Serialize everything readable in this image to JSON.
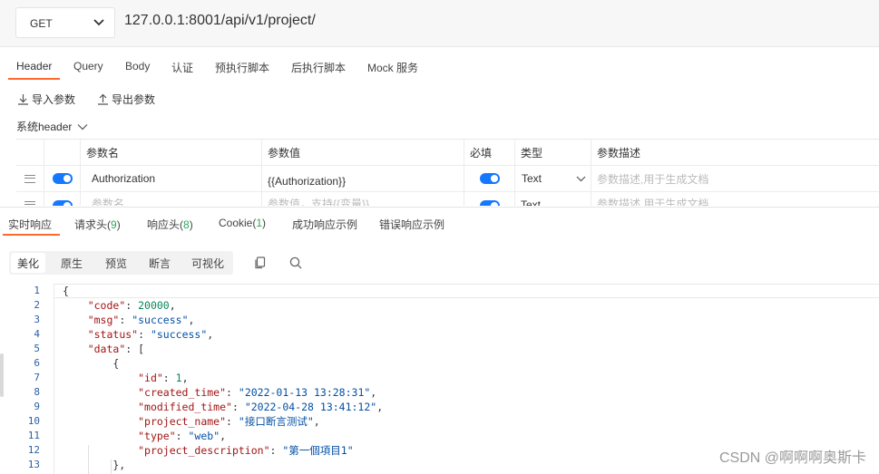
{
  "request": {
    "method": "GET",
    "url": "127.0.0.1:8001/api/v1/project/"
  },
  "req_tabs": [
    "Header",
    "Query",
    "Body",
    "认证",
    "预执行脚本",
    "后执行脚本",
    "Mock 服务"
  ],
  "actions": {
    "import": "导入参数",
    "export": "导出参数"
  },
  "sys_header": "系统header",
  "table": {
    "headers": [
      "参数名",
      "参数值",
      "必填",
      "类型",
      "参数描述"
    ],
    "rows": [
      {
        "name": "Authorization",
        "value": "{{Authorization}}",
        "type": "Text",
        "desc_placeholder": "参数描述,用于生成文档"
      },
      {
        "name_placeholder": "参数名",
        "value_placeholder": "参数值，支持{{变量}}",
        "type": "Text",
        "desc_placeholder": "参数描述,用于生成文档"
      }
    ]
  },
  "resp_tabs": {
    "realtime": "实时响应",
    "req_headers": "请求头",
    "req_headers_count": "9",
    "resp_headers": "响应头",
    "resp_headers_count": "8",
    "cookie": "Cookie",
    "cookie_count": "1",
    "success_example": "成功响应示例",
    "error_example": "错误响应示例"
  },
  "view_modes": [
    "美化",
    "原生",
    "预览",
    "断言",
    "可视化"
  ],
  "icons": [
    "copy-icon",
    "search-icon",
    "upload-icon",
    "download-icon",
    "chevron-down-icon",
    "drag-handle-icon"
  ],
  "code_lines": [
    "1",
    "2",
    "3",
    "4",
    "5",
    "6",
    "7",
    "8",
    "9",
    "10",
    "11",
    "12",
    "13"
  ],
  "json_body": {
    "code_key": "\"code\"",
    "code_val": "20000",
    "msg_key": "\"msg\"",
    "msg_val": "\"success\"",
    "status_key": "\"status\"",
    "status_val": "\"success\"",
    "data_key": "\"data\"",
    "id_key": "\"id\"",
    "id_val": "1",
    "created_key": "\"created_time\"",
    "created_val": "\"2022-01-13 13:28:31\"",
    "modified_key": "\"modified_time\"",
    "modified_val": "\"2022-04-28 13:41:12\"",
    "pname_key": "\"project_name\"",
    "pname_val": "\"接口断言测试\"",
    "type_key": "\"type\"",
    "type_val": "\"web\"",
    "pdesc_key": "\"project_description\"",
    "pdesc_val": "\"第一個項目1\""
  },
  "watermark": "CSDN @啊啊啊奥斯卡",
  "colors": {
    "accent": "#ff6a2c",
    "toggle": "#1677ff",
    "count": "#2aa85a"
  }
}
